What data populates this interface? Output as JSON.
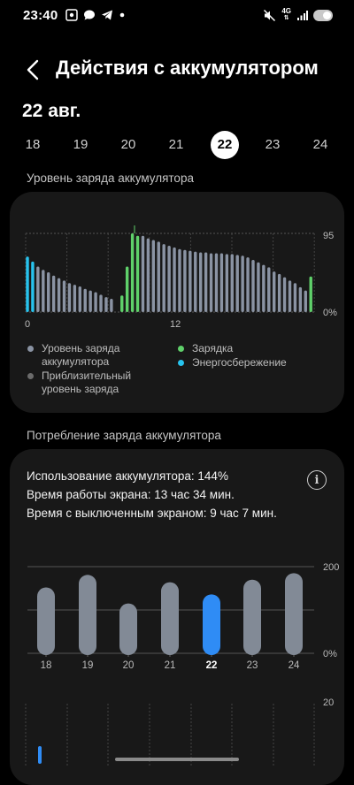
{
  "status_bar": {
    "time": "23:40",
    "network": "4G",
    "left_icons": [
      "screenshot-icon",
      "message-icon",
      "telegram-icon",
      "dot-icon"
    ],
    "right_icons": [
      "mute-icon",
      "network-4g-icon",
      "signal-icon",
      "battery-icon"
    ]
  },
  "header": {
    "back_icon": "chevron-left-icon",
    "title": "Действия с аккумулятором"
  },
  "date_title": "22 авг.",
  "days": [
    {
      "label": "18",
      "selected": false
    },
    {
      "label": "19",
      "selected": false
    },
    {
      "label": "20",
      "selected": false
    },
    {
      "label": "21",
      "selected": false
    },
    {
      "label": "22",
      "selected": true
    },
    {
      "label": "23",
      "selected": false
    },
    {
      "label": "24",
      "selected": false
    }
  ],
  "level_section": {
    "title": "Уровень заряда аккумулятора",
    "y_top_label": "95",
    "y_bottom_label": "0%",
    "x_labels": [
      "0",
      "12"
    ],
    "legend": {
      "level": "Уровень заряда аккумулятора",
      "estimated": "Приблизительный уровень заряда",
      "charging": "Зарядка",
      "saving": "Энергосбережение"
    }
  },
  "consumption_section": {
    "title": "Потребление заряда аккумулятора",
    "usage_line": "Использование аккумулятора: 144%",
    "screen_on_line": "Время работы экрана: 13 час 34 мин.",
    "screen_off_line": "Время с выключенным экраном: 9 час 7 мин.",
    "info_icon": "info-icon",
    "y_top_label": "200",
    "y_bottom_label": "0%",
    "second_chart_top_label": "20"
  },
  "colors": {
    "level": "#8a93a3",
    "charging": "#5fd06a",
    "saving": "#27c3ee",
    "selected_bar": "#2f8cf5",
    "bar": "#828a96"
  },
  "chart_data": [
    {
      "type": "bar",
      "title": "Уровень заряда аккумулятора",
      "x_tick_labels": [
        "0",
        "12"
      ],
      "ylim": [
        0,
        95
      ],
      "y_tick_labels": [
        "95",
        "0%"
      ],
      "series": [
        {
          "name": "Уровень заряда аккумулятора",
          "values": [
            null,
            null,
            55,
            51,
            48,
            44,
            41,
            38,
            35,
            33,
            31,
            28,
            26,
            24,
            21,
            18,
            16,
            null,
            null,
            null,
            null,
            null,
            92,
            89,
            87,
            85,
            82,
            80,
            78,
            76,
            75,
            74,
            73,
            72,
            72,
            71,
            71,
            71,
            70,
            70,
            69,
            68,
            66,
            63,
            60,
            57,
            54,
            49,
            46,
            42,
            38,
            35,
            30,
            26,
            null,
            null
          ]
        },
        {
          "name": "Зарядка",
          "values": [
            null,
            null,
            null,
            null,
            null,
            null,
            null,
            null,
            null,
            null,
            null,
            null,
            null,
            null,
            null,
            null,
            null,
            null,
            20,
            55,
            95,
            92,
            null,
            null,
            null,
            null,
            null,
            null,
            null,
            null,
            null,
            null,
            null,
            null,
            null,
            null,
            null,
            null,
            null,
            null,
            null,
            null,
            null,
            null,
            null,
            null,
            null,
            null,
            null,
            null,
            null,
            null,
            null,
            null,
            43,
            null
          ]
        },
        {
          "name": "Энергосбережение",
          "values": [
            67,
            61,
            null,
            null,
            null,
            null,
            null,
            null,
            null,
            null,
            null,
            null,
            null,
            null,
            null,
            null,
            null,
            null,
            null,
            null,
            null,
            null,
            null,
            null,
            null,
            null,
            null,
            null,
            null,
            null,
            null,
            null,
            null,
            null,
            null,
            null,
            null,
            null,
            null,
            null,
            null,
            null,
            null,
            null,
            null,
            null,
            null,
            null,
            null,
            null,
            null,
            null,
            null,
            null,
            null,
            null
          ]
        }
      ]
    },
    {
      "type": "bar",
      "title": "Потребление заряда аккумулятора",
      "categories": [
        "18",
        "19",
        "20",
        "21",
        "22",
        "23",
        "24"
      ],
      "values": [
        152,
        181,
        115,
        164,
        136,
        170,
        185
      ],
      "selected_category": "22",
      "ylim": [
        0,
        200
      ],
      "y_tick_labels": [
        "200",
        "0%"
      ]
    }
  ]
}
